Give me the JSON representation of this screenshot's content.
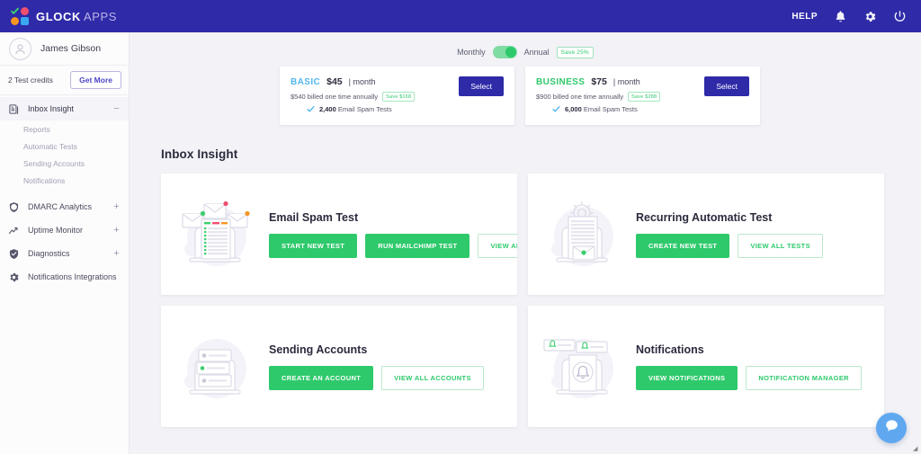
{
  "topbar": {
    "logo_text": "GLOCK",
    "logo_suffix": "APPS",
    "help_label": "HELP",
    "icons": [
      "bell-icon",
      "gear-icon",
      "power-icon"
    ],
    "bg_color": "#2f2aa8"
  },
  "sidebar": {
    "user_name": "James Gibson",
    "credits_text": "2 Test credits",
    "get_more_label": "Get More",
    "nav": [
      {
        "label": "Inbox Insight",
        "icon": "inbox-icon",
        "active": true,
        "expander": "−",
        "children": [
          {
            "label": "Reports"
          },
          {
            "label": "Automatic Tests"
          },
          {
            "label": "Sending Accounts"
          },
          {
            "label": "Notifications"
          }
        ]
      },
      {
        "label": "DMARC Analytics",
        "icon": "shield-globe-icon",
        "active": false,
        "expander": "+",
        "children": []
      },
      {
        "label": "Uptime Monitor",
        "icon": "trend-up-icon",
        "active": false,
        "expander": "+",
        "children": []
      },
      {
        "label": "Diagnostics",
        "icon": "shield-check-icon",
        "active": false,
        "expander": "+",
        "children": []
      },
      {
        "label": "Notifications Integrations",
        "icon": "gear-icon",
        "active": false,
        "expander": "",
        "children": []
      }
    ]
  },
  "billing": {
    "monthly_label": "Monthly",
    "annual_label": "Annual",
    "save_badge": "Save 25%",
    "selected": "Annual"
  },
  "plans": [
    {
      "name": "BASIC",
      "name_color": "#53b6f0",
      "price": "$45",
      "period": "| month",
      "billed": "$540 billed one time annually",
      "save": "Save $168",
      "feature_value": "2,400",
      "feature_text": "Email Spam Tests",
      "select_label": "Select"
    },
    {
      "name": "BUSINESS",
      "name_color": "#2ec96b",
      "price": "$75",
      "period": "| month",
      "billed": "$900 billed one time annually",
      "save": "Save $288",
      "feature_value": "6,000",
      "feature_text": "Email Spam Tests",
      "select_label": "Select"
    }
  ],
  "main": {
    "section_title": "Inbox Insight",
    "cards": [
      {
        "title": "Email Spam Test",
        "illustration": "laptop-envelopes-icon",
        "buttons": [
          {
            "label": "START NEW TEST",
            "style": "solid"
          },
          {
            "label": "RUN MAILCHIMP TEST",
            "style": "solid"
          },
          {
            "label": "VIEW ALL TESTS",
            "style": "ghost"
          }
        ]
      },
      {
        "title": "Recurring Automatic Test",
        "illustration": "laptop-gear-icon",
        "buttons": [
          {
            "label": "CREATE NEW TEST",
            "style": "solid"
          },
          {
            "label": "VIEW ALL TESTS",
            "style": "ghost"
          }
        ]
      },
      {
        "title": "Sending Accounts",
        "illustration": "laptop-accounts-icon",
        "buttons": [
          {
            "label": "CREATE AN ACCOUNT",
            "style": "solid"
          },
          {
            "label": "VIEW ALL ACCOUNTS",
            "style": "ghost"
          }
        ]
      },
      {
        "title": "Notifications",
        "illustration": "laptop-bell-icon",
        "buttons": [
          {
            "label": "VIEW NOTIFICATIONS",
            "style": "solid"
          },
          {
            "label": "NOTIFICATION MANAGER",
            "style": "ghost"
          }
        ]
      }
    ]
  },
  "chat": {
    "icon": "chat-bubble-icon",
    "color": "#5fa8f0"
  }
}
